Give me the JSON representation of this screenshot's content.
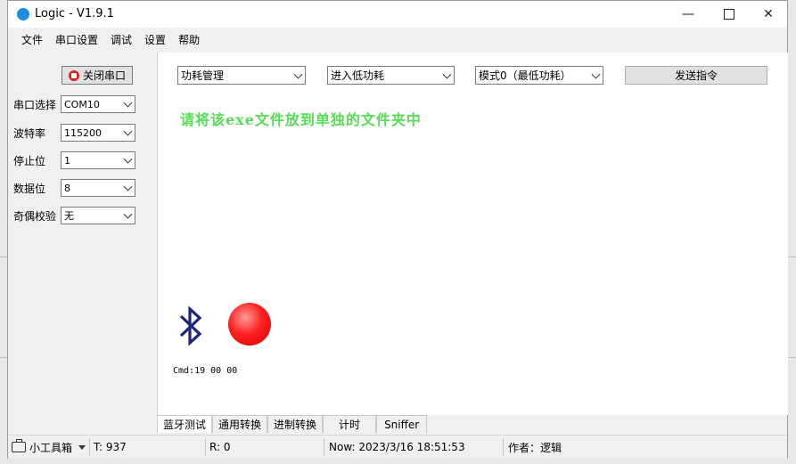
{
  "window": {
    "title": "Logic - V1.9.1"
  },
  "menu": [
    "文件",
    "串口设置",
    "调试",
    "设置",
    "帮助"
  ],
  "serial": {
    "close_button": "关闭串口",
    "fields": [
      {
        "label": "串口选择",
        "value": "COM10"
      },
      {
        "label": "波特率",
        "value": "115200"
      },
      {
        "label": "停止位",
        "value": "1"
      },
      {
        "label": "数据位",
        "value": "8"
      },
      {
        "label": "奇偶校验",
        "value": "无"
      }
    ]
  },
  "controls": {
    "category": "功耗管理",
    "action": "进入低功耗",
    "mode": "模式0（最低功耗）",
    "send_button": "发送指令"
  },
  "notice": "请将该exe文件放到单独的文件夹中",
  "cmd": "Cmd:19 00 00",
  "tabs": [
    "蓝牙测试",
    "通用转换",
    "进制转换",
    "计时",
    "Sniffer"
  ],
  "status": {
    "toolbox": "小工具箱",
    "tx": "T:  937",
    "rx": "R:  0",
    "now": "Now:  2023/3/16  18:51:53",
    "author": "作者：逻辑"
  },
  "colors": {
    "notice": "#55dd55",
    "led": "#ff2020",
    "bluetooth": "#1a237e"
  },
  "icons": {
    "bluetooth": "bluetooth-icon",
    "led": "status-led",
    "stop": "stop-icon"
  }
}
